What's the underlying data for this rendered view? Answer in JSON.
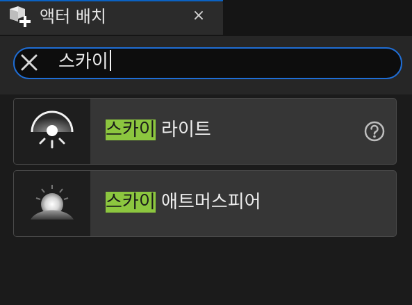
{
  "tab": {
    "title": "액터 배치",
    "icon": "place-actor-icon",
    "close_label": "×"
  },
  "search": {
    "query": "스카이",
    "clear_icon": "clear-x-icon"
  },
  "results": [
    {
      "match": "스카이",
      "rest": " 라이트",
      "icon": "sky-light-icon",
      "help_icon": "help-question-icon"
    },
    {
      "match": "스카이",
      "rest": " 애트머스피어",
      "icon": "sky-atmosphere-icon"
    }
  ],
  "colors": {
    "accent": "#1f6ed6",
    "match_highlight": "#8cc63f"
  }
}
